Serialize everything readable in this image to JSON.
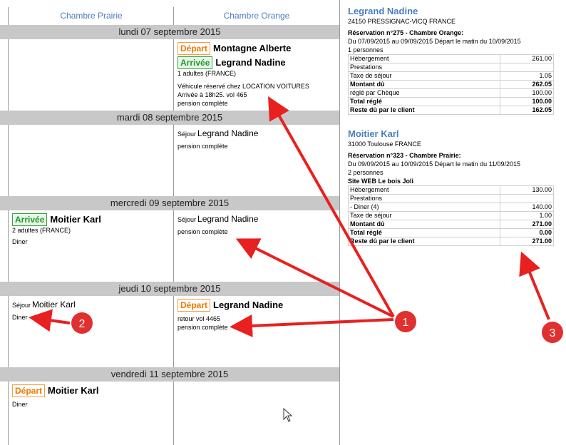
{
  "planning": {
    "columns": [
      "Chambre Prairie",
      "Chambre Orange"
    ],
    "days": [
      {
        "date": "lundi 07 septembre 2015",
        "prairie": {},
        "orange": {
          "depart_badge": "Départ",
          "depart_name": "Montagne Alberte",
          "arrival_badge": "Arrivée",
          "arrival_name": "Legrand Nadine",
          "lines": [
            "1 adultes (FRANCE)",
            "",
            "Véhicule réservé chez LOCATION VOITURES",
            "Arrivée à 18h25. vol 465",
            "pension complète"
          ]
        }
      },
      {
        "date": "mardi 08 septembre 2015",
        "prairie": {},
        "orange": {
          "sejour_label": "Séjour",
          "sejour_name": "Legrand Nadine",
          "lines": [
            "pension complète"
          ]
        }
      },
      {
        "date": "mercredi 09 septembre 2015",
        "prairie": {
          "arrival_badge": "Arrivée",
          "arrival_name": "Moitier Karl",
          "lines": [
            "2 adultes (FRANCE)",
            "Diner"
          ]
        },
        "orange": {
          "sejour_label": "Séjour",
          "sejour_name": "Legrand Nadine",
          "lines": [
            "pension complète"
          ]
        }
      },
      {
        "date": "jeudi 10 septembre 2015",
        "prairie": {
          "sejour_label": "Séjour",
          "sejour_name": "Moitier Karl",
          "lines": [
            "Diner"
          ]
        },
        "orange": {
          "depart_badge": "Départ",
          "depart_name": "Legrand Nadine",
          "lines": [
            "retour vol 4465",
            "pension complète"
          ]
        }
      },
      {
        "date": "vendredi 11 septembre 2015",
        "prairie": {
          "depart_badge": "Départ",
          "depart_name": "Moitier Karl",
          "lines": [
            "Diner"
          ]
        },
        "orange": {}
      }
    ]
  },
  "clients": [
    {
      "name": "Legrand Nadine",
      "address": "24150 PRESSIGNAC-VICQ FRANCE",
      "reservation": "Réservation n°275 - Chambre Orange:",
      "dates": "Du 07/09/2015 au 09/09/2015 Départ le matin du 10/09/2015",
      "persons": "1 personnes",
      "rows": [
        {
          "label": "Hébergement",
          "value": "261.00",
          "bold": false
        },
        {
          "label": "Prestations",
          "value": "",
          "bold": false
        },
        {
          "label": "Taxe de séjour",
          "value": "1.05",
          "bold": false
        },
        {
          "label": "Montant dû",
          "value": "262.05",
          "bold": true
        },
        {
          "label": "réglé par Chèque",
          "value": "100.00",
          "bold": false
        },
        {
          "label": "Total réglé",
          "value": "100.00",
          "bold": true
        },
        {
          "label": "Reste dû par le client",
          "value": "162.05",
          "bold": true
        }
      ]
    },
    {
      "name": "Moitier Karl",
      "address": "31000 Toulouse FRANCE",
      "reservation": "Réservation n°323 - Chambre Prairie:",
      "dates": "Du 09/09/2015 au 10/09/2015 Départ le matin du 11/09/2015",
      "persons": "2 personnes",
      "site": "Site WEB Le bois Joli",
      "rows": [
        {
          "label": "Hébergement",
          "value": "130.00",
          "bold": false
        },
        {
          "label": "Prestations",
          "value": "",
          "bold": false
        },
        {
          "label": "- Diner (4)",
          "value": "140.00",
          "bold": false
        },
        {
          "label": "Taxe de séjour",
          "value": "1.00",
          "bold": false
        },
        {
          "label": "Montant dû",
          "value": "271.00",
          "bold": true
        },
        {
          "label": "Total réglé",
          "value": "0.00",
          "bold": true
        },
        {
          "label": "Reste dû par le client",
          "value": "271.00",
          "bold": true
        }
      ]
    }
  ],
  "annotations": [
    {
      "label": "1",
      "color": "#e03030"
    },
    {
      "label": "2",
      "color": "#e03030"
    },
    {
      "label": "3",
      "color": "#e03030"
    }
  ],
  "colors": {
    "accent": "#4a7fc0",
    "depart": "#ee7a00",
    "arrivee": "#1f9a2a",
    "arrow": "#e82020",
    "day_header": "#c8c8c8"
  }
}
